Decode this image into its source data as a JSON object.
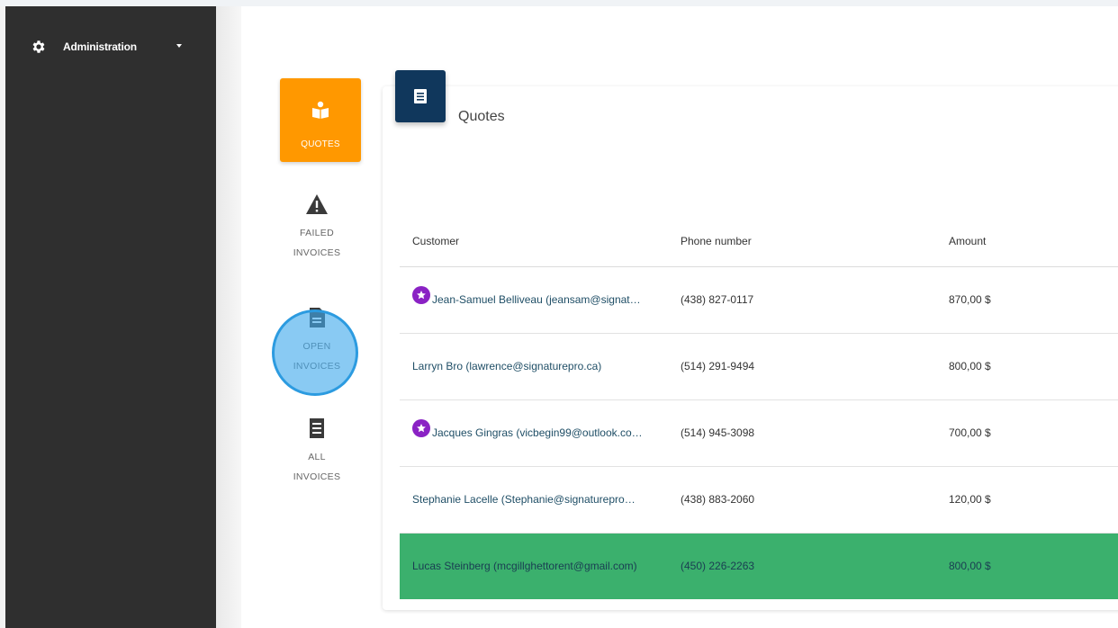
{
  "sidebar": {
    "admin_label": "Administration"
  },
  "nav": {
    "quotes_label": "QUOTES",
    "failed": [
      "FAILED",
      "INVOICES"
    ],
    "open": [
      "OPEN",
      "INVOICES"
    ],
    "all": [
      "ALL",
      "INVOICES"
    ]
  },
  "card": {
    "title": "Quotes"
  },
  "table": {
    "headers": [
      "Customer",
      "Phone number",
      "Amount"
    ],
    "rows": [
      {
        "customer": "Jean-Samuel Belliveau (jeansam@signat…",
        "phone": "(438) 827-0117",
        "amount": "870,00 $",
        "starred": true
      },
      {
        "customer": "Larryn Bro (lawrence@signaturepro.ca)",
        "phone": "(514) 291-9494",
        "amount": "800,00 $",
        "starred": false
      },
      {
        "customer": "Jacques Gingras (vicbegin99@outlook.co…",
        "phone": "(514) 945-3098",
        "amount": "700,00 $",
        "starred": true
      },
      {
        "customer": "Stephanie Lacelle (Stephanie@signaturepro.ca)",
        "phone": "(438) 883-2060",
        "amount": "120,00 $",
        "starred": false
      },
      {
        "customer": "Lucas Steinberg (mcgillghettorent@gmail.com)",
        "phone": "(450) 226-2263",
        "amount": "800,00 $",
        "starred": false
      }
    ]
  },
  "colors": {
    "sidebar": "#2f2f2f",
    "quotes_tile": "#ff9800",
    "card_icon": "#10375c",
    "highlight_row": "#3bb06d",
    "star": "#8a22c4",
    "click_ring": "#2c9be0"
  },
  "icons": {
    "admin": "gear-icon",
    "quotes": "quote-reader-icon",
    "failed": "warning-icon",
    "open": "document-icon",
    "all": "list-document-icon",
    "card": "list-document-icon",
    "starred": "star-badge-icon"
  }
}
